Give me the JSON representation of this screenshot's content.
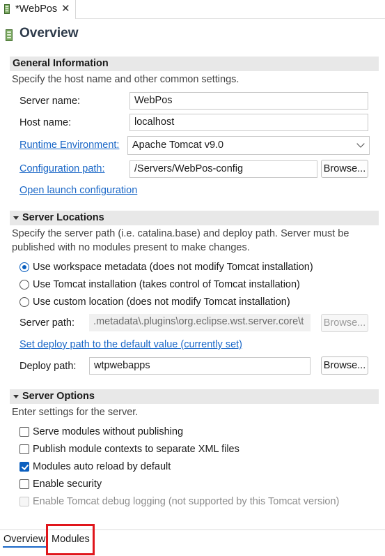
{
  "editor_tab": {
    "title": "*WebPos",
    "close_glyph": "✕",
    "icon": "server-icon"
  },
  "page": {
    "title": "Overview",
    "icon": "server-icon"
  },
  "general_info": {
    "header": "General Information",
    "description": "Specify the host name and other common settings.",
    "server_name_label": "Server name:",
    "server_name_value": "WebPos",
    "host_name_label": "Host name:",
    "host_name_value": "localhost",
    "runtime_env_label": "Runtime Environment:",
    "runtime_env_value": "Apache Tomcat v9.0",
    "config_path_label": "Configuration path:",
    "config_path_value": "/Servers/WebPos-config",
    "browse_label": "Browse...",
    "open_launch_label": "Open launch configuration"
  },
  "server_locations": {
    "header": "Server Locations",
    "description_line1": "Specify the server path (i.e. catalina.base) and deploy path. Server must be",
    "description_line2": "published with no modules present to make changes.",
    "options": [
      {
        "label": "Use workspace metadata (does not modify Tomcat installation)",
        "selected": true
      },
      {
        "label": "Use Tomcat installation (takes control of Tomcat installation)",
        "selected": false
      },
      {
        "label": "Use custom location (does not modify Tomcat installation)",
        "selected": false
      }
    ],
    "server_path_label": "Server path:",
    "server_path_value": ".metadata\\.plugins\\org.eclipse.wst.server.core\\t",
    "browse_label": "Browse...",
    "set_deploy_link": "Set deploy path to the default value (currently set)",
    "deploy_path_label": "Deploy path:",
    "deploy_path_value": "wtpwebapps"
  },
  "server_options": {
    "header": "Server Options",
    "description": "Enter settings for the server.",
    "options": [
      {
        "label": "Serve modules without publishing",
        "checked": false,
        "enabled": true
      },
      {
        "label": "Publish module contexts to separate XML files",
        "checked": false,
        "enabled": true
      },
      {
        "label": "Modules auto reload by default",
        "checked": true,
        "enabled": true
      },
      {
        "label": "Enable security",
        "checked": false,
        "enabled": true
      },
      {
        "label": "Enable Tomcat debug logging (not supported by this Tomcat version)",
        "checked": false,
        "enabled": false
      }
    ]
  },
  "bottom_tabs": [
    {
      "label": "Overview",
      "active": true
    },
    {
      "label": "Modules",
      "active": false
    }
  ],
  "colors": {
    "link": "#1a67c7",
    "accent": "#0b5fbf",
    "highlight": "#e0161c",
    "section_header_bg": "#e8e8e8"
  }
}
